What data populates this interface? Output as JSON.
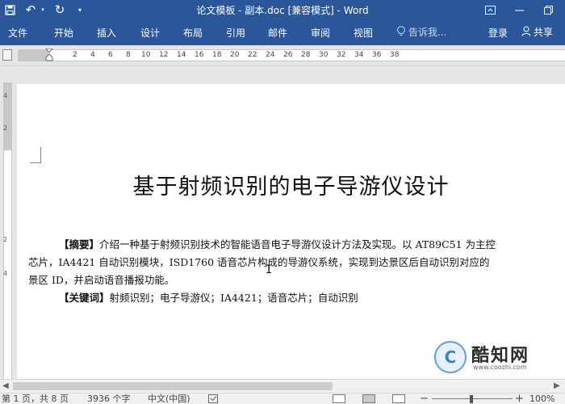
{
  "titlebar": {
    "title": "论文模板 - 副本.doc [兼容模式] - Word",
    "quick_access": {
      "save_icon": "save-icon",
      "undo_icon": "undo-icon",
      "redo_icon": "redo-icon",
      "customize_icon": "customize-qat-icon"
    },
    "window_buttons": {
      "ribbon_options": "ribbon-display-icon",
      "minimize": "minimize-icon",
      "restore": "restore-icon"
    }
  },
  "ribbon": {
    "tabs": [
      "文件",
      "开始",
      "插入",
      "设计",
      "布局",
      "引用",
      "邮件",
      "审阅",
      "视图"
    ],
    "tellme_placeholder": "告诉我...",
    "login_label": "登录",
    "share_label": "共享"
  },
  "ruler": {
    "numbers": [
      "2",
      "4",
      "6",
      "8",
      "10",
      "12",
      "14",
      "16",
      "18",
      "20",
      "22",
      "24",
      "26",
      "28",
      "30",
      "32",
      "34",
      "36",
      "38"
    ],
    "vertical_numbers": [
      "4",
      "2",
      "2",
      "4"
    ]
  },
  "document": {
    "heading": "基于射频识别的电子导游仪设计",
    "abstract_label": "【摘要】",
    "abstract_line1": "介绍一种基于射频识别技术的智能语音电子导游仪设计方法及实现。以 AT89C51 为主控",
    "abstract_line2": "芯片，IA4421 自动识别模块，ISD1760 语音芯片构成的导游仪系统，实现到达景区后自动识别对应的",
    "abstract_line3": "景区 ID，并启动语音播报功能。",
    "keywords_label": "【关键词】",
    "keywords": "射频识别；电子导游仪；IA4421；语音芯片；自动识别"
  },
  "watermark": {
    "logo_letter": "C",
    "name": "酷知网",
    "url": "www.coozhi.com"
  },
  "statusbar": {
    "page": "第 1 页，共 8 页",
    "words": "3936 个字",
    "language": "中文(中国)",
    "zoom": "100%"
  },
  "colors": {
    "ribbon": "#2b579a",
    "workspace": "#e6e6e6",
    "logo_accent": "#3b82c6"
  }
}
